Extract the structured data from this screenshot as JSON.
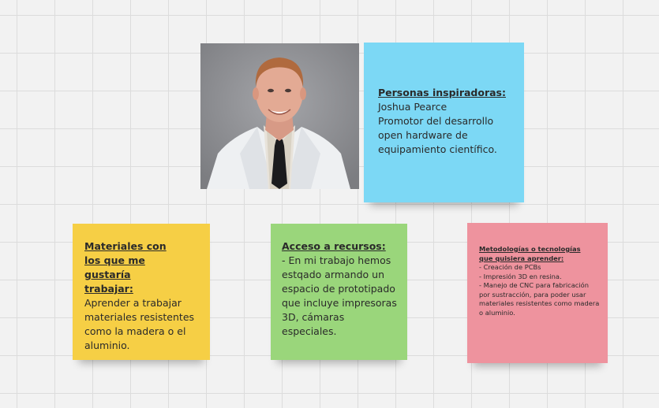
{
  "photo": {
    "alt": "Foto de Joshua Pearce"
  },
  "notes": {
    "blue": {
      "title": "Personas inspiradoras:",
      "body": "Joshua Pearce\nPromotor del desarrollo open hardware de equipamiento científico.",
      "color": "#7cd8f5"
    },
    "yellow": {
      "title": "Materiales con los que me gustaría trabajar:",
      "body": "Aprender a trabajar materiales resistentes como la madera o el aluminio.",
      "color": "#f6cf45"
    },
    "green": {
      "title": "Acceso a recursos:",
      "body": "- En mi trabajo hemos estqado armando un espacio de prototipado que incluye impresoras 3D, cámaras especiales.",
      "color": "#9ad67b"
    },
    "pink": {
      "title": "Metodologías o tecnologías que quisiera aprender:",
      "body": "- Creación de PCBs\n- Impresión 3D en resina.\n- Manejo de CNC para fabricación por sustracción, para poder usar materiales resistentes como madera o aluminio.",
      "color": "#ee939e"
    }
  }
}
